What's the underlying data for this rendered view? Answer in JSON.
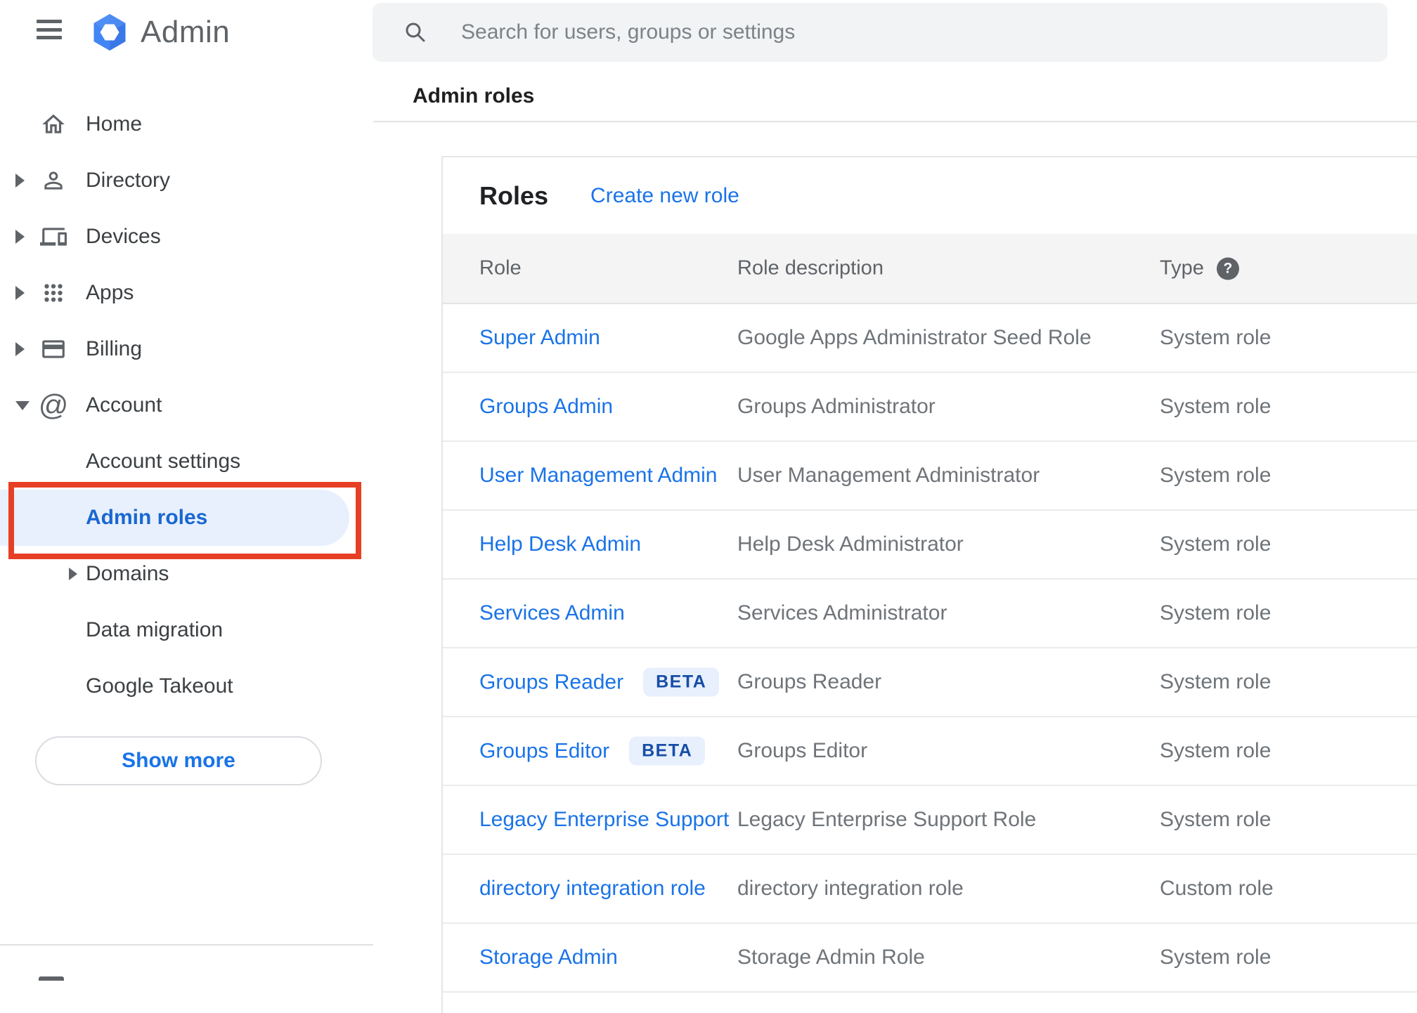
{
  "app": {
    "logo_label": "Admin"
  },
  "sidebar": {
    "nav": [
      {
        "label": "Home",
        "icon": "home-icon",
        "expand": "none"
      },
      {
        "label": "Directory",
        "icon": "person-icon",
        "expand": "right"
      },
      {
        "label": "Devices",
        "icon": "devices-icon",
        "expand": "right"
      },
      {
        "label": "Apps",
        "icon": "apps-icon",
        "expand": "right"
      },
      {
        "label": "Billing",
        "icon": "card-icon",
        "expand": "right"
      },
      {
        "label": "Account",
        "icon": "at-icon",
        "expand": "down"
      }
    ],
    "account_children": [
      {
        "label": "Account settings",
        "expand": "none",
        "selected": false
      },
      {
        "label": "Admin roles",
        "expand": "none",
        "selected": true
      },
      {
        "label": "Domains",
        "expand": "right",
        "selected": false
      },
      {
        "label": "Data migration",
        "expand": "none",
        "selected": false
      },
      {
        "label": "Google Takeout",
        "expand": "none",
        "selected": false
      }
    ],
    "show_more_label": "Show more",
    "annotation": {
      "shape": "red-highlight-box",
      "color": "#e73f25",
      "target": "Admin roles"
    }
  },
  "search": {
    "placeholder": "Search for users, groups or settings",
    "icon": "search-icon"
  },
  "breadcrumb": "Admin roles",
  "roles_card": {
    "title": "Roles",
    "create_link": "Create new role",
    "columns": [
      "Role",
      "Role description",
      "Type"
    ],
    "type_help_icon": "help-icon",
    "beta_label": "BETA",
    "rows": [
      {
        "role": "Super Admin",
        "beta": false,
        "description": "Google Apps Administrator Seed Role",
        "type": "System role"
      },
      {
        "role": "Groups Admin",
        "beta": false,
        "description": "Groups Administrator",
        "type": "System role"
      },
      {
        "role": "User Management Admin",
        "beta": false,
        "description": "User Management Administrator",
        "type": "System role"
      },
      {
        "role": "Help Desk Admin",
        "beta": false,
        "description": "Help Desk Administrator",
        "type": "System role"
      },
      {
        "role": "Services Admin",
        "beta": false,
        "description": "Services Administrator",
        "type": "System role"
      },
      {
        "role": "Groups Reader",
        "beta": true,
        "description": "Groups Reader",
        "type": "System role"
      },
      {
        "role": "Groups Editor",
        "beta": true,
        "description": "Groups Editor",
        "type": "System role"
      },
      {
        "role": "Legacy Enterprise Support",
        "beta": false,
        "description": "Legacy Enterprise Support Role",
        "type": "System role"
      },
      {
        "role": "directory integration role",
        "beta": false,
        "description": "directory integration role",
        "type": "Custom role"
      },
      {
        "role": "Storage Admin",
        "beta": false,
        "description": "Storage Admin Role",
        "type": "System role"
      }
    ]
  },
  "colors": {
    "link_blue": "#1a73e8",
    "selected_item_text": "#1967d2",
    "selected_item_bg": "#e8f0fe",
    "annotation_red": "#e73f25",
    "beta_bg": "#e8f0fe",
    "beta_text": "#174ea6",
    "table_header_bg": "#f4f4f4",
    "search_bg": "#f1f3f4",
    "icon_gray": "#5f6368"
  }
}
